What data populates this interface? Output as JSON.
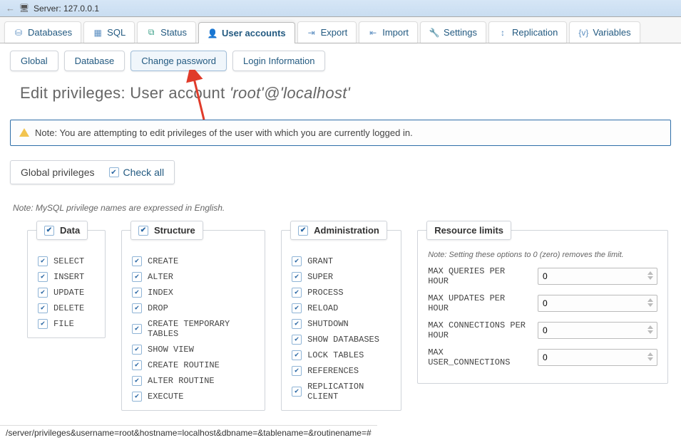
{
  "server_bar": {
    "label": "Server: 127.0.0.1"
  },
  "nav": [
    {
      "id": "databases",
      "label": "Databases",
      "icon": "disk-icon",
      "color": "icon-col"
    },
    {
      "id": "sql",
      "label": "SQL",
      "icon": "sql-icon",
      "color": "icon-col"
    },
    {
      "id": "status",
      "label": "Status",
      "icon": "status-icon",
      "color": "icon-teal"
    },
    {
      "id": "user-accounts",
      "label": "User accounts",
      "icon": "user-icon",
      "color": "icon-orange",
      "active": true
    },
    {
      "id": "export",
      "label": "Export",
      "icon": "export-icon",
      "color": "icon-col"
    },
    {
      "id": "import",
      "label": "Import",
      "icon": "import-icon",
      "color": "icon-col"
    },
    {
      "id": "settings",
      "label": "Settings",
      "icon": "wrench-icon",
      "color": "icon-gray"
    },
    {
      "id": "replication",
      "label": "Replication",
      "icon": "replication-icon",
      "color": "icon-col"
    },
    {
      "id": "variables",
      "label": "Variables",
      "icon": "variables-icon",
      "color": "icon-col"
    }
  ],
  "subnav": {
    "global": "Global",
    "database": "Database",
    "change_password": "Change password",
    "login_info": "Login Information"
  },
  "title": {
    "prefix": "Edit privileges: User account ",
    "account": "'root'@'localhost'"
  },
  "notice": "Note: You are attempting to edit privileges of the user with which you are currently logged in.",
  "global_privileges": {
    "label": "Global privileges",
    "check_all": "Check all"
  },
  "english_note": "Note: MySQL privilege names are expressed in English.",
  "groups": {
    "data": {
      "label": "Data",
      "items": [
        "SELECT",
        "INSERT",
        "UPDATE",
        "DELETE",
        "FILE"
      ]
    },
    "structure": {
      "label": "Structure",
      "items": [
        "CREATE",
        "ALTER",
        "INDEX",
        "DROP",
        "CREATE TEMPORARY TABLES",
        "SHOW VIEW",
        "CREATE ROUTINE",
        "ALTER ROUTINE",
        "EXECUTE"
      ]
    },
    "administration": {
      "label": "Administration",
      "items": [
        "GRANT",
        "SUPER",
        "PROCESS",
        "RELOAD",
        "SHUTDOWN",
        "SHOW DATABASES",
        "LOCK TABLES",
        "REFERENCES",
        "REPLICATION CLIENT"
      ]
    }
  },
  "resource_limits": {
    "label": "Resource limits",
    "note": "Note: Setting these options to 0 (zero) removes the limit.",
    "rows": [
      {
        "label": "MAX QUERIES PER HOUR",
        "value": "0"
      },
      {
        "label": "MAX UPDATES PER HOUR",
        "value": "0"
      },
      {
        "label": "MAX CONNECTIONS PER HOUR",
        "value": "0"
      },
      {
        "label": "MAX USER_CONNECTIONS",
        "value": "0"
      }
    ]
  },
  "status_path": "/server/privileges&username=root&hostname=localhost&dbname=&tablename=&routinename=#"
}
